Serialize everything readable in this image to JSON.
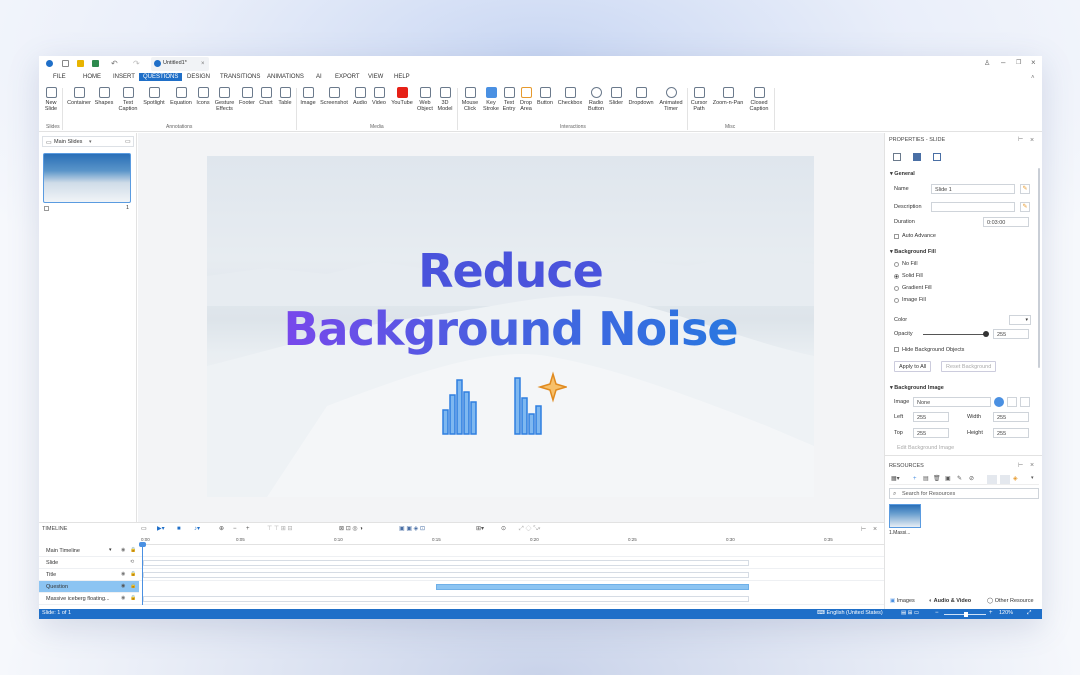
{
  "titlebar": {
    "tab_title": "Untitled1*"
  },
  "menu": [
    "FILE",
    "HOME",
    "INSERT",
    "QUESTIONS",
    "DESIGN",
    "TRANSITIONS",
    "ANIMATIONS",
    "AI",
    "EXPORT",
    "VIEW",
    "HELP"
  ],
  "ribbon": {
    "items": [
      "New Slide",
      "Container",
      "Shapes",
      "Text Caption",
      "Spotlight",
      "Equation",
      "Icons",
      "Gesture Effects",
      "Footer",
      "Chart",
      "Table",
      "Image",
      "Screenshot",
      "Audio",
      "Video",
      "YouTube",
      "Web Object",
      "3D Model",
      "Mouse Click",
      "Key Stroke",
      "Text Entry",
      "Drop Area",
      "Button",
      "Checkbox",
      "Radio Button",
      "Slider",
      "Dropdown",
      "Animated Timer",
      "Cursor Path",
      "Zoom-n-Pan",
      "Closed Caption"
    ],
    "groups": [
      "Slides",
      "Annotations",
      "Media",
      "Interactions",
      "Misc"
    ]
  },
  "left_panel": {
    "title": "Main Slides",
    "slide_number": "1"
  },
  "slide": {
    "line1": "Reduce",
    "line2": "Background Noise"
  },
  "properties": {
    "title": "PROPERTIES - SLIDE",
    "general": "General",
    "name_label": "Name",
    "name_value": "Slide 1",
    "description_label": "Description",
    "duration_label": "Duration",
    "duration_value": "0:03:00",
    "auto_advance": "Auto Advance",
    "background_fill": "Background Fill",
    "no_fill": "No Fill",
    "solid_fill": "Solid Fill",
    "gradient_fill": "Gradient Fill",
    "image_fill": "Image Fill",
    "color_label": "Color",
    "opacity_label": "Opacity",
    "opacity_value": "255",
    "hide_bg_objects": "Hide Background Objects",
    "apply_all": "Apply to All",
    "reset_bg": "Reset Background",
    "background_image": "Background Image",
    "image_label": "Image",
    "image_value": "None",
    "left_label": "Left",
    "left_value": "255",
    "width_label": "Width",
    "width_value": "255",
    "top_label": "Top",
    "top_value": "255",
    "height_label": "Height",
    "height_value": "255",
    "edit_bg_image": "Edit Background Image"
  },
  "resources": {
    "title": "RESOURCES",
    "search_placeholder": "Search for Resources",
    "thumb_label": "1.Massi...",
    "tabs": [
      "Images",
      "Audio & Video",
      "Other Resource"
    ]
  },
  "timeline": {
    "title": "TIMELINE",
    "ticks": [
      "0:00",
      "0:05",
      "0:10",
      "0:15",
      "0:20",
      "0:25",
      "0:30",
      "0:35"
    ],
    "rows": [
      "Main Timeline",
      "Slide",
      "Title",
      "Question",
      "Massive iceberg floating..."
    ]
  },
  "status": {
    "left": "Slide: 1 of 1",
    "language": "English (United States)",
    "zoom": "120%"
  },
  "colors": {
    "accent": "#1f6fc8",
    "title_gradient_start": "#8a3ff0",
    "title_gradient_end": "#1f7fe0",
    "question_bar": "#8cc4f2"
  }
}
